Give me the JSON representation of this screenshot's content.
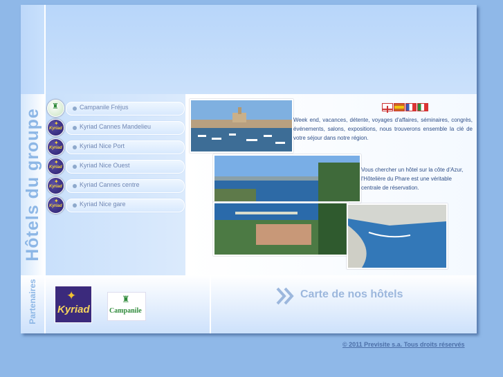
{
  "sidebar": {
    "title": "Hôtels du groupe",
    "hotels": [
      {
        "label": "Campanile Fréjus",
        "brand": "campanile"
      },
      {
        "label": "Kyriad Cannes Mandelieu",
        "brand": "kyriad"
      },
      {
        "label": "Kyriad Nice Port",
        "brand": "kyriad"
      },
      {
        "label": "Kyriad Nice Ouest",
        "brand": "kyriad"
      },
      {
        "label": "Kyriad Cannes centre",
        "brand": "kyriad"
      },
      {
        "label": "Kyriad Nice gare",
        "brand": "kyriad"
      }
    ]
  },
  "logos": {
    "kyriad_small": "Kyriad",
    "kyriad_big": "Kyriad",
    "campanile": "Campanile"
  },
  "content": {
    "languages": [
      "english-flag",
      "spanish-flag",
      "french-flag",
      "italian-flag"
    ],
    "intro": "Week end, vacances, détente, voyages d'affaires, séminaires, congrès, événements, salons, expositions, nous trouverons ensemble la clé de votre séjour dans notre région.",
    "intro2": "Vous chercher un hôtel sur la côte d'Azur, l'Hôtelière du Phare est une véritable centrale de réservation."
  },
  "partners": {
    "label": "Partenaires"
  },
  "map_link": {
    "label": "Carte de nos hôtels"
  },
  "footer": {
    "copyright": "© 2011 Previsite s.a. Tous droits réservés"
  },
  "colors": {
    "page_bg": "#8fb8e8",
    "title_blue": "#8db7e6",
    "text_blue": "#2f4f88",
    "kyriad_purple": "#3b2a7c",
    "campanile_green": "#2f8a3a"
  }
}
